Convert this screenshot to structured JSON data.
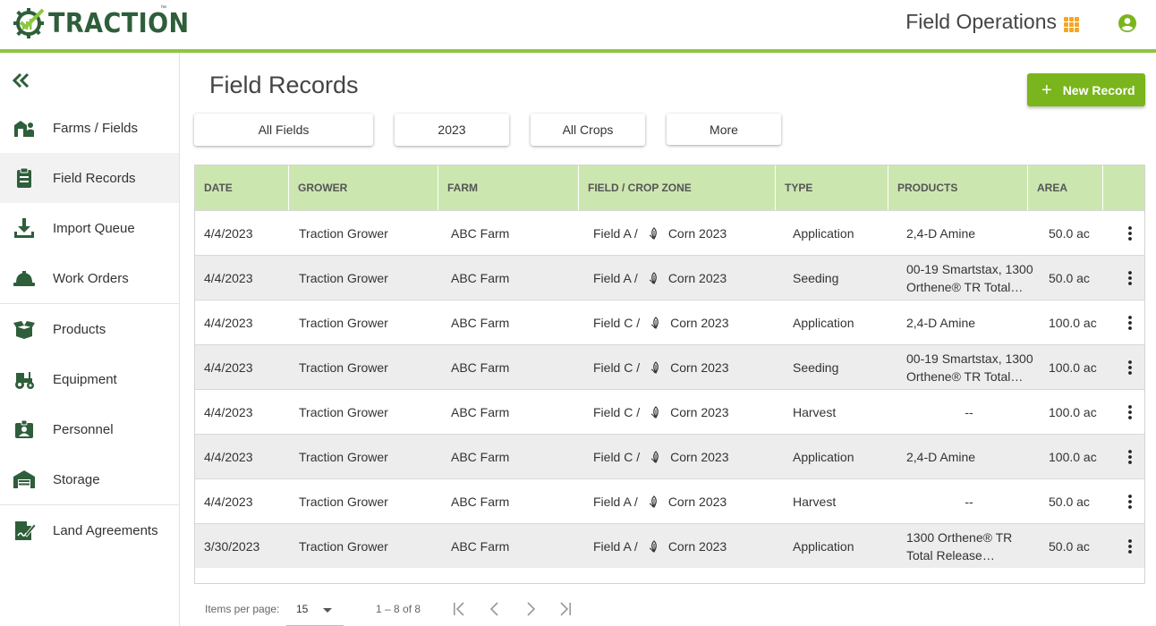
{
  "brand": {
    "name": "TRACTION",
    "tm": "™",
    "primary": "#2e5e3a",
    "accent": "#8dc63f"
  },
  "header": {
    "app_title": "Field Operations",
    "apps_icon": "apps-grid-icon",
    "user_icon": "account-circle-icon"
  },
  "sidebar": {
    "collapse_icon": "double-chevron-left-icon",
    "items": [
      {
        "label": "Farms / Fields",
        "icon": "barn-person-icon"
      },
      {
        "label": "Field Records",
        "icon": "clipboard-icon",
        "active": true
      },
      {
        "label": "Import Queue",
        "icon": "download-tray-icon"
      },
      {
        "label": "Work Orders",
        "icon": "hard-hat-icon"
      },
      {
        "label": "Products",
        "icon": "open-box-icon"
      },
      {
        "label": "Equipment",
        "icon": "tractor-icon"
      },
      {
        "label": "Personnel",
        "icon": "id-badge-icon"
      },
      {
        "label": "Storage",
        "icon": "warehouse-icon"
      },
      {
        "label": "Land Agreements",
        "icon": "signed-document-icon"
      }
    ]
  },
  "main": {
    "title": "Field Records",
    "new_button": {
      "icon": "+",
      "label": "New Record"
    },
    "filters": [
      "All Fields",
      "2023",
      "All Crops",
      "More"
    ]
  },
  "table": {
    "columns": [
      "DATE",
      "GROWER",
      "FARM",
      "FIELD / CROP ZONE",
      "TYPE",
      "PRODUCTS",
      "AREA"
    ],
    "rows": [
      {
        "date": "4/4/2023",
        "grower": "Traction Grower",
        "farm": "ABC Farm",
        "field": "Field A /",
        "crop_zone": "Corn 2023",
        "type": "Application",
        "products": [
          "2,4-D Amine"
        ],
        "area": "50.0 ac"
      },
      {
        "date": "4/4/2023",
        "grower": "Traction Grower",
        "farm": "ABC Farm",
        "field": "Field A /",
        "crop_zone": "Corn 2023",
        "type": "Seeding",
        "products": [
          "00-19 Smartstax, 1300",
          "Orthene® TR Total…"
        ],
        "area": "50.0 ac"
      },
      {
        "date": "4/4/2023",
        "grower": "Traction Grower",
        "farm": "ABC Farm",
        "field": "Field C /",
        "crop_zone": "Corn 2023",
        "type": "Application",
        "products": [
          "2,4-D Amine"
        ],
        "area": "100.0 ac"
      },
      {
        "date": "4/4/2023",
        "grower": "Traction Grower",
        "farm": "ABC Farm",
        "field": "Field C /",
        "crop_zone": "Corn 2023",
        "type": "Seeding",
        "products": [
          "00-19 Smartstax, 1300",
          "Orthene® TR Total…"
        ],
        "area": "100.0 ac"
      },
      {
        "date": "4/4/2023",
        "grower": "Traction Grower",
        "farm": "ABC Farm",
        "field": "Field C /",
        "crop_zone": "Corn 2023",
        "type": "Harvest",
        "products": [
          "--"
        ],
        "area": "100.0 ac"
      },
      {
        "date": "4/4/2023",
        "grower": "Traction Grower",
        "farm": "ABC Farm",
        "field": "Field C /",
        "crop_zone": "Corn 2023",
        "type": "Application",
        "products": [
          "2,4-D Amine"
        ],
        "area": "100.0 ac"
      },
      {
        "date": "4/4/2023",
        "grower": "Traction Grower",
        "farm": "ABC Farm",
        "field": "Field A /",
        "crop_zone": "Corn 2023",
        "type": "Harvest",
        "products": [
          "--"
        ],
        "area": "50.0 ac"
      },
      {
        "date": "3/30/2023",
        "grower": "Traction Grower",
        "farm": "ABC Farm",
        "field": "Field A /",
        "crop_zone": "Corn 2023",
        "type": "Application",
        "products": [
          "1300 Orthene® TR",
          "Total Release…"
        ],
        "area": "50.0 ac"
      }
    ]
  },
  "pagination": {
    "items_per_page_label": "Items per page:",
    "items_per_page": "15",
    "range": "1 – 8 of 8",
    "icons": [
      "first-page-icon",
      "previous-page-icon",
      "next-page-icon",
      "last-page-icon"
    ]
  }
}
